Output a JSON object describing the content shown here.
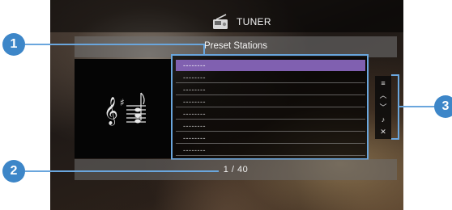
{
  "header": {
    "title": "TUNER",
    "source_icon": "radio-tuner-icon"
  },
  "list_title": "Preset Stations",
  "album_art": {
    "icon": "music-notes-icon"
  },
  "presets": [
    "--------",
    "--------",
    "--------",
    "--------",
    "--------",
    "--------",
    "--------",
    "--------"
  ],
  "selected_index": 0,
  "menu": [
    {
      "icon": "menu-icon",
      "glyph": "≡"
    },
    {
      "icon": "page-up-icon",
      "glyph": "︿"
    },
    {
      "icon": "page-down-icon",
      "glyph": "﹀"
    },
    {
      "icon": "now-playing-icon",
      "glyph": "♪"
    },
    {
      "icon": "close-icon",
      "glyph": "✕"
    }
  ],
  "footer": {
    "page_indicator": "1 / 40"
  },
  "callouts": {
    "one": "1",
    "two": "2",
    "three": "3"
  },
  "colors": {
    "accent": "#6aa6dd",
    "callout": "#3d86c8",
    "selected_row": "#8060b0"
  }
}
